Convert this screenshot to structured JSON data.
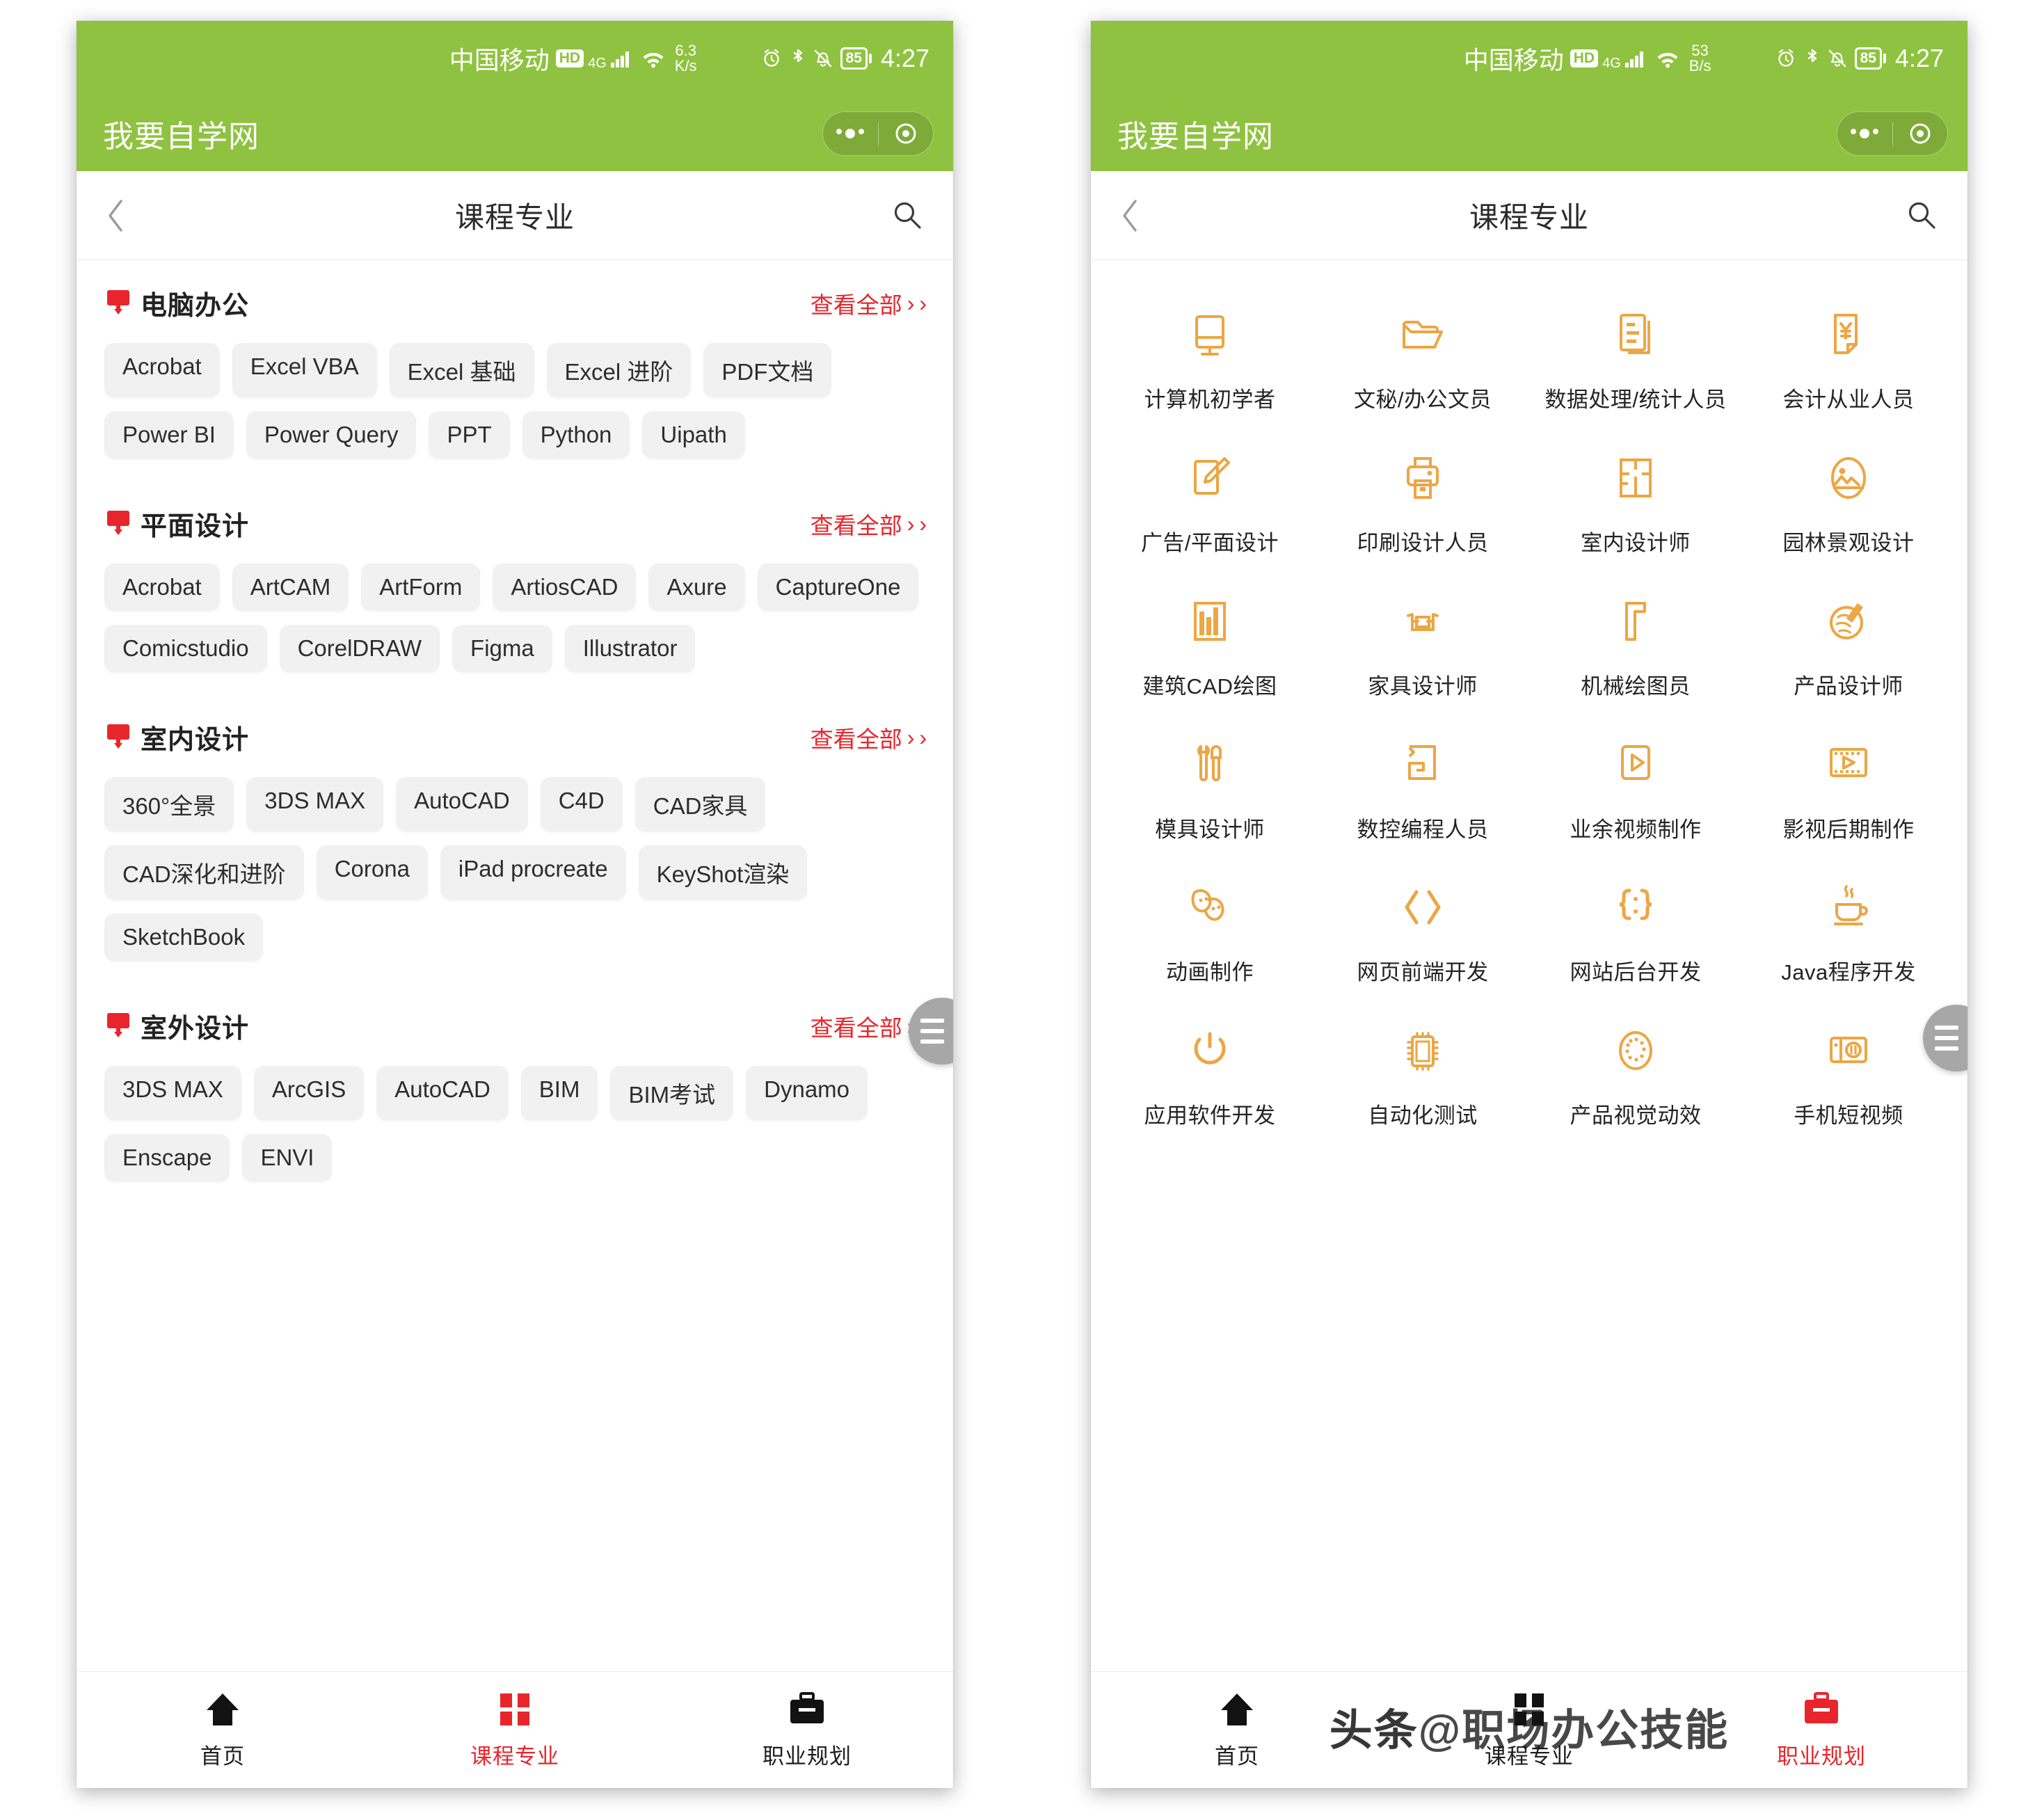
{
  "statusbar": {
    "carrier": "中国移动",
    "hd_badge": "HD",
    "network": "4G",
    "speed_left": "6.3",
    "speed_unit_left": "K/s",
    "speed_right": "53",
    "speed_unit_right": "B/s",
    "battery": "85",
    "time": "4:27",
    "icons": [
      "signal-icon",
      "wifi-icon",
      "alarm-icon",
      "bluetooth-icon",
      "mute-icon",
      "battery-icon"
    ]
  },
  "miniprogram": {
    "title": "我要自学网",
    "capsule_menu": "more-dots-icon",
    "capsule_close": "target-circle-icon"
  },
  "navbar": {
    "back": "chevron-left-icon",
    "title": "课程专业",
    "search": "search-icon"
  },
  "left_page": {
    "more_label": "查看全部",
    "sections": [
      {
        "name": "电脑办公",
        "tags": [
          "Acrobat",
          "Excel VBA",
          "Excel 基础",
          "Excel 进阶",
          "PDF文档",
          "Power BI",
          "Power Query",
          "PPT",
          "Python",
          "Uipath"
        ]
      },
      {
        "name": "平面设计",
        "tags": [
          "Acrobat",
          "ArtCAM",
          "ArtForm",
          "ArtiosCAD",
          "Axure",
          "CaptureOne",
          "Comicstudio",
          "CorelDRAW",
          "Figma",
          "Illustrator"
        ]
      },
      {
        "name": "室内设计",
        "tags": [
          "360°全景",
          "3DS MAX",
          "AutoCAD",
          "C4D",
          "CAD家具",
          "CAD深化和进阶",
          "Corona",
          "iPad procreate",
          "KeyShot渲染",
          "SketchBook"
        ]
      },
      {
        "name": "室外设计",
        "tags": [
          "3DS MAX",
          "ArcGIS",
          "AutoCAD",
          "BIM",
          "BIM考试",
          "Dynamo",
          "Enscape",
          "ENVI"
        ]
      }
    ]
  },
  "right_page": {
    "occupations": [
      {
        "label": "计算机初学者",
        "icon": "monitor-icon"
      },
      {
        "label": "文秘/办公文员",
        "icon": "folder-icon"
      },
      {
        "label": "数据处理/统计人员",
        "icon": "document-list-icon"
      },
      {
        "label": "会计从业人员",
        "icon": "invoice-yuan-icon"
      },
      {
        "label": "广告/平面设计",
        "icon": "pencil-edit-icon"
      },
      {
        "label": "印刷设计人员",
        "icon": "printer-icon"
      },
      {
        "label": "室内设计师",
        "icon": "floorplan-icon"
      },
      {
        "label": "园林景观设计",
        "icon": "landscape-image-icon"
      },
      {
        "label": "建筑CAD绘图",
        "icon": "buildings-icon"
      },
      {
        "label": "家具设计师",
        "icon": "table-chairs-icon"
      },
      {
        "label": "机械绘图员",
        "icon": "set-square-icon"
      },
      {
        "label": "产品设计师",
        "icon": "palette-brush-icon"
      },
      {
        "label": "模具设计师",
        "icon": "wrench-screwdriver-icon"
      },
      {
        "label": "数控编程人员",
        "icon": "cnc-path-icon"
      },
      {
        "label": "业余视频制作",
        "icon": "video-play-icon"
      },
      {
        "label": "影视后期制作",
        "icon": "film-strip-icon"
      },
      {
        "label": "动画制作",
        "icon": "theater-masks-icon"
      },
      {
        "label": "网页前端开发",
        "icon": "angle-brackets-icon"
      },
      {
        "label": "网站后台开发",
        "icon": "curly-braces-icon"
      },
      {
        "label": "Java程序开发",
        "icon": "java-cup-icon"
      },
      {
        "label": "应用软件开发",
        "icon": "power-button-icon"
      },
      {
        "label": "自动化测试",
        "icon": "chip-icon"
      },
      {
        "label": "产品视觉动效",
        "icon": "dotted-circle-icon"
      },
      {
        "label": "手机短视频",
        "icon": "video-camera-icon"
      }
    ]
  },
  "fab": {
    "icon": "hamburger-menu-icon"
  },
  "tabbar": {
    "tabs": [
      {
        "label": "首页",
        "icon": "home-icon"
      },
      {
        "label": "课程专业",
        "icon": "grid-icon"
      },
      {
        "label": "职业规划",
        "icon": "briefcase-icon"
      }
    ],
    "active_left": "课程专业",
    "active_right": "职业规划"
  },
  "watermark": {
    "prefix": "头条",
    "handle": "@职场办公技能"
  },
  "colors": {
    "brand_green": "#8fc240",
    "accent_red": "#e8252b",
    "icon_orange": "#eca644",
    "tag_bg": "#f1f1f1"
  }
}
